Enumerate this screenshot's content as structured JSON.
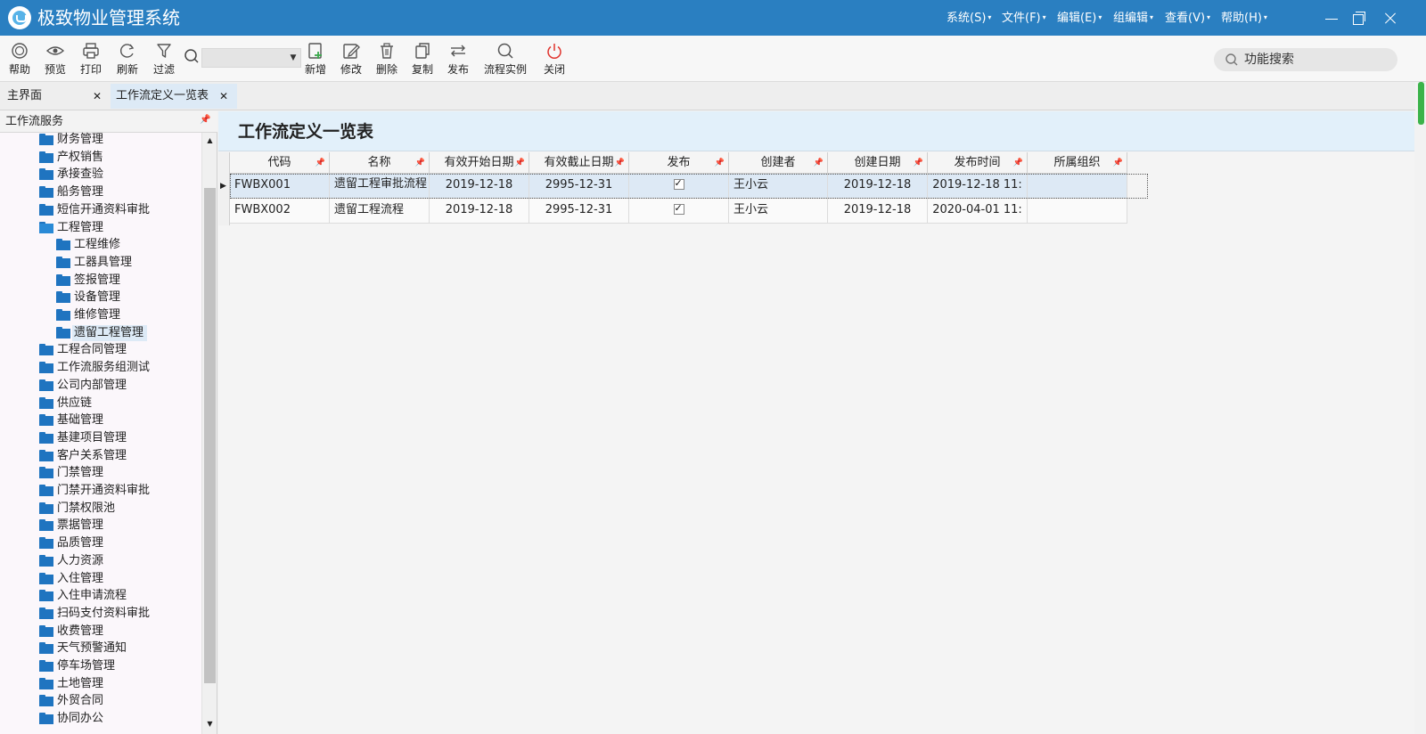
{
  "titlebar": {
    "title": "极致物业管理系统",
    "menu": [
      "系统(S)",
      "文件(F)",
      "编辑(E)",
      "组编辑",
      "查看(V)",
      "帮助(H)"
    ]
  },
  "toolbar": {
    "buttons_left": [
      {
        "label": "帮助",
        "icon": "help-circle-icon"
      },
      {
        "label": "预览",
        "icon": "eye-icon"
      },
      {
        "label": "打印",
        "icon": "printer-icon"
      },
      {
        "label": "刷新",
        "icon": "refresh-icon"
      },
      {
        "label": "过滤",
        "icon": "filter-icon"
      }
    ],
    "buttons_right": [
      {
        "label": "新增",
        "icon": "add-document-icon"
      },
      {
        "label": "修改",
        "icon": "edit-icon"
      },
      {
        "label": "删除",
        "icon": "trash-icon"
      },
      {
        "label": "复制",
        "icon": "copy-icon"
      },
      {
        "label": "发布",
        "icon": "publish-arrows-icon"
      },
      {
        "label": "流程实例",
        "icon": "search-icon"
      },
      {
        "label": "关闭",
        "icon": "power-icon"
      }
    ],
    "search_value": "",
    "function_search_label": "功能搜索"
  },
  "tabs": [
    {
      "label": "主界面"
    },
    {
      "label": "工作流定义一览表"
    }
  ],
  "left_panel": {
    "title": "工作流服务",
    "tree": [
      {
        "label": "财务管理",
        "level": 1
      },
      {
        "label": "产权销售",
        "level": 1
      },
      {
        "label": "承接查验",
        "level": 1
      },
      {
        "label": "船务管理",
        "level": 1
      },
      {
        "label": "短信开通资料审批",
        "level": 1
      },
      {
        "label": "工程管理",
        "level": 1,
        "open": true
      },
      {
        "label": "工程维修",
        "level": 2
      },
      {
        "label": "工器具管理",
        "level": 2
      },
      {
        "label": "签报管理",
        "level": 2
      },
      {
        "label": "设备管理",
        "level": 2
      },
      {
        "label": "维修管理",
        "level": 2
      },
      {
        "label": "遗留工程管理",
        "level": 2,
        "selected": true
      },
      {
        "label": "工程合同管理",
        "level": 1
      },
      {
        "label": "工作流服务组测试",
        "level": 1
      },
      {
        "label": "公司内部管理",
        "level": 1
      },
      {
        "label": "供应链",
        "level": 1
      },
      {
        "label": "基础管理",
        "level": 1
      },
      {
        "label": "基建项目管理",
        "level": 1
      },
      {
        "label": "客户关系管理",
        "level": 1
      },
      {
        "label": "门禁管理",
        "level": 1
      },
      {
        "label": "门禁开通资料审批",
        "level": 1
      },
      {
        "label": "门禁权限池",
        "level": 1
      },
      {
        "label": "票据管理",
        "level": 1
      },
      {
        "label": "品质管理",
        "level": 1
      },
      {
        "label": "人力资源",
        "level": 1
      },
      {
        "label": "入住管理",
        "level": 1
      },
      {
        "label": "入住申请流程",
        "level": 1
      },
      {
        "label": "扫码支付资料审批",
        "level": 1
      },
      {
        "label": "收费管理",
        "level": 1
      },
      {
        "label": "天气预警通知",
        "level": 1
      },
      {
        "label": "停车场管理",
        "level": 1
      },
      {
        "label": "土地管理",
        "level": 1
      },
      {
        "label": "外贸合同",
        "level": 1
      },
      {
        "label": "协同办公",
        "level": 1
      }
    ]
  },
  "content": {
    "title": "工作流定义一览表",
    "columns": [
      "代码",
      "名称",
      "有效开始日期",
      "有效截止日期",
      "发布",
      "创建者",
      "创建日期",
      "发布时间",
      "所属组织"
    ],
    "rows": [
      {
        "code": "FWBX001",
        "name": "遗留工程审批流程",
        "start": "2019-12-18",
        "end": "2995-12-31",
        "published": true,
        "creator": "王小云",
        "created": "2019-12-18",
        "publish_time": "2019-12-18 11:",
        "org": ""
      },
      {
        "code": "FWBX002",
        "name": "遗留工程流程",
        "start": "2019-12-18",
        "end": "2995-12-31",
        "published": true,
        "creator": "王小云",
        "created": "2019-12-18",
        "publish_time": "2020-04-01 11:",
        "org": ""
      }
    ]
  },
  "colors": {
    "titlebar_bg": "#2a7fc1",
    "folder": "#1f74c0",
    "selected_row": "#dde9f5",
    "content_header_bg": "#e2f0fa",
    "close_icon": "#e0322c",
    "add_icon": "#3aa84c"
  }
}
